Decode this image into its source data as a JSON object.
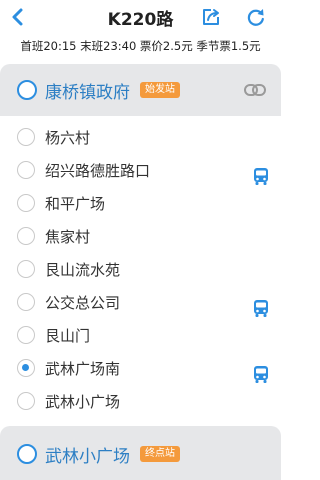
{
  "header": {
    "title": "K220路",
    "back_icon": "chevron-left-icon",
    "share_icon": "share-icon",
    "refresh_icon": "refresh-icon"
  },
  "info": {
    "text": "首班20:15 末班23:40 票价2.5元 季节票1.5元"
  },
  "start": {
    "name": "康桥镇政府",
    "tag": "始发站",
    "link_icon": "link-icon"
  },
  "stops": [
    {
      "name": "杨六村",
      "bus": false,
      "selected": false
    },
    {
      "name": "绍兴路德胜路口",
      "bus": true,
      "selected": false
    },
    {
      "name": "和平广场",
      "bus": false,
      "selected": false
    },
    {
      "name": "焦家村",
      "bus": false,
      "selected": false
    },
    {
      "name": "艮山流水苑",
      "bus": false,
      "selected": false
    },
    {
      "name": "公交总公司",
      "bus": true,
      "selected": false
    },
    {
      "name": "艮山门",
      "bus": false,
      "selected": false
    },
    {
      "name": "武林广场南",
      "bus": true,
      "selected": true
    },
    {
      "name": "武林小广场",
      "bus": false,
      "selected": false
    }
  ],
  "end": {
    "name": "武林小广场",
    "tag": "终点站"
  },
  "colors": {
    "accent": "#2c8ee0",
    "station_text": "#2d7fc4",
    "tag": "#f49a3c",
    "card_bg": "#e6e7e9"
  }
}
